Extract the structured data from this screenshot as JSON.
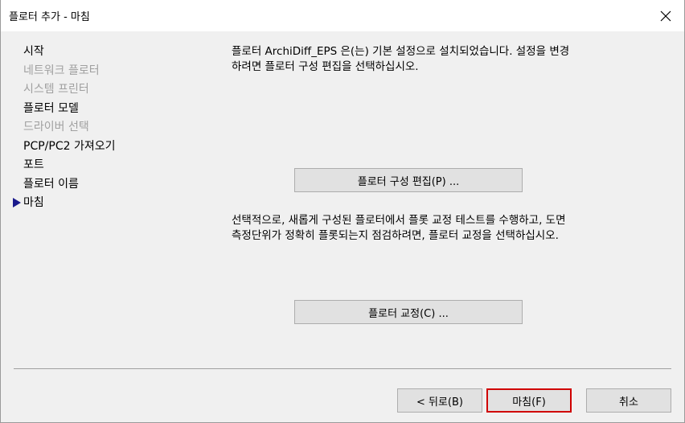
{
  "window": {
    "title": "플로터 추가 - 마침"
  },
  "icons": {
    "close": "close-icon",
    "current_step": "current-step-arrow-icon"
  },
  "steps": [
    {
      "label": "시작",
      "state": "enabled"
    },
    {
      "label": "네트워크 플로터",
      "state": "disabled"
    },
    {
      "label": "시스템 프린터",
      "state": "disabled"
    },
    {
      "label": "플로터 모델",
      "state": "enabled"
    },
    {
      "label": "드라이버 선택",
      "state": "disabled"
    },
    {
      "label": "PCP/PC2 가져오기",
      "state": "enabled"
    },
    {
      "label": "포트",
      "state": "enabled"
    },
    {
      "label": "플로터 이름",
      "state": "enabled"
    },
    {
      "label": "마침",
      "state": "current"
    }
  ],
  "content": {
    "paragraph1": "플로터 ArchiDiff_EPS 은(는) 기본 설정으로 설치되었습니다. 설정을 변경하려면 플로터 구성 편집을 선택하십시오.",
    "edit_button": "플로터 구성 편집(P) ...",
    "paragraph2": "선택적으로, 새롭게 구성된 플로터에서 플롯 교정 테스트를 수행하고, 도면 측정단위가 정확히 플롯되는지 점검하려면, 플로터 교정을 선택하십시오.",
    "calibrate_button": "플로터 교정(C) ..."
  },
  "footer": {
    "back_button": "< 뒤로(B)",
    "finish_button": "마침(F)",
    "cancel_button": "취소"
  },
  "colors": {
    "finish_highlight": "#d00000",
    "current_arrow": "#1a1a8c",
    "disabled_text": "#a0a0a0"
  }
}
